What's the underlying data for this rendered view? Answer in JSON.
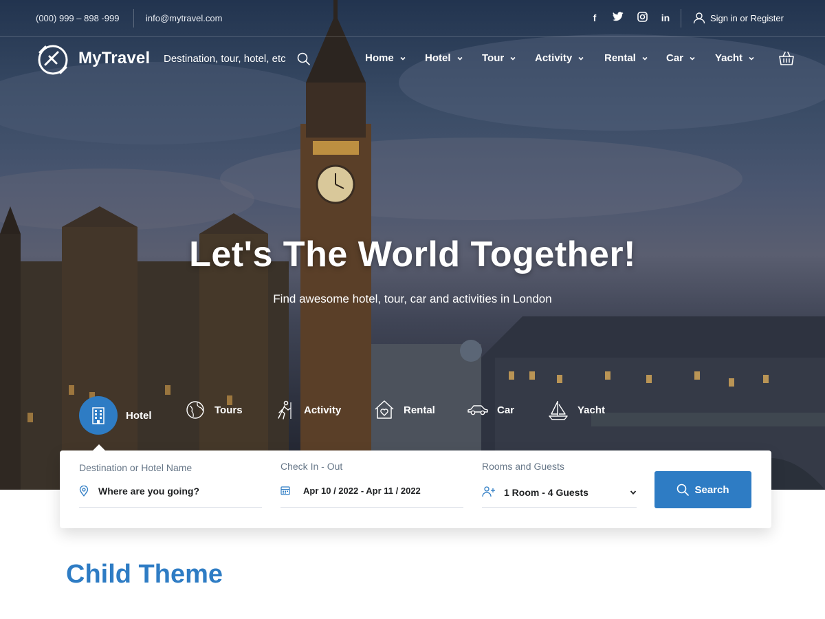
{
  "topbar": {
    "phone": "(000) 999 – 898 -999",
    "email": "info@mytravel.com",
    "social": [
      "facebook-icon",
      "twitter-icon",
      "instagram-icon",
      "linkedin-icon"
    ],
    "signin": "Sign in or Register"
  },
  "header": {
    "brand": "MyTravel",
    "search_hint": "Destination, tour, hotel, etc",
    "nav": [
      "Home",
      "Hotel",
      "Tour",
      "Activity",
      "Rental",
      "Car",
      "Yacht"
    ]
  },
  "hero": {
    "title": "Let's The World Together!",
    "subtitle": "Find awesome hotel, tour, car and activities in London"
  },
  "categories": {
    "active": "Hotel",
    "items": [
      "Tours",
      "Activity",
      "Rental",
      "Car",
      "Yacht"
    ]
  },
  "search": {
    "destination_label": "Destination or Hotel Name",
    "destination_placeholder": "Where are you going?",
    "dates_label": "Check In - Out",
    "dates_value": "Apr 10 / 2022 - Apr 11 / 2022",
    "guests_label": "Rooms and Guests",
    "guests_value": "1 Room - 4 Guests",
    "button": "Search"
  },
  "section": {
    "title": "Child Theme"
  },
  "colors": {
    "accent": "#2e7cc4",
    "text_dark": "#1e2022",
    "text_muted": "#677788"
  }
}
